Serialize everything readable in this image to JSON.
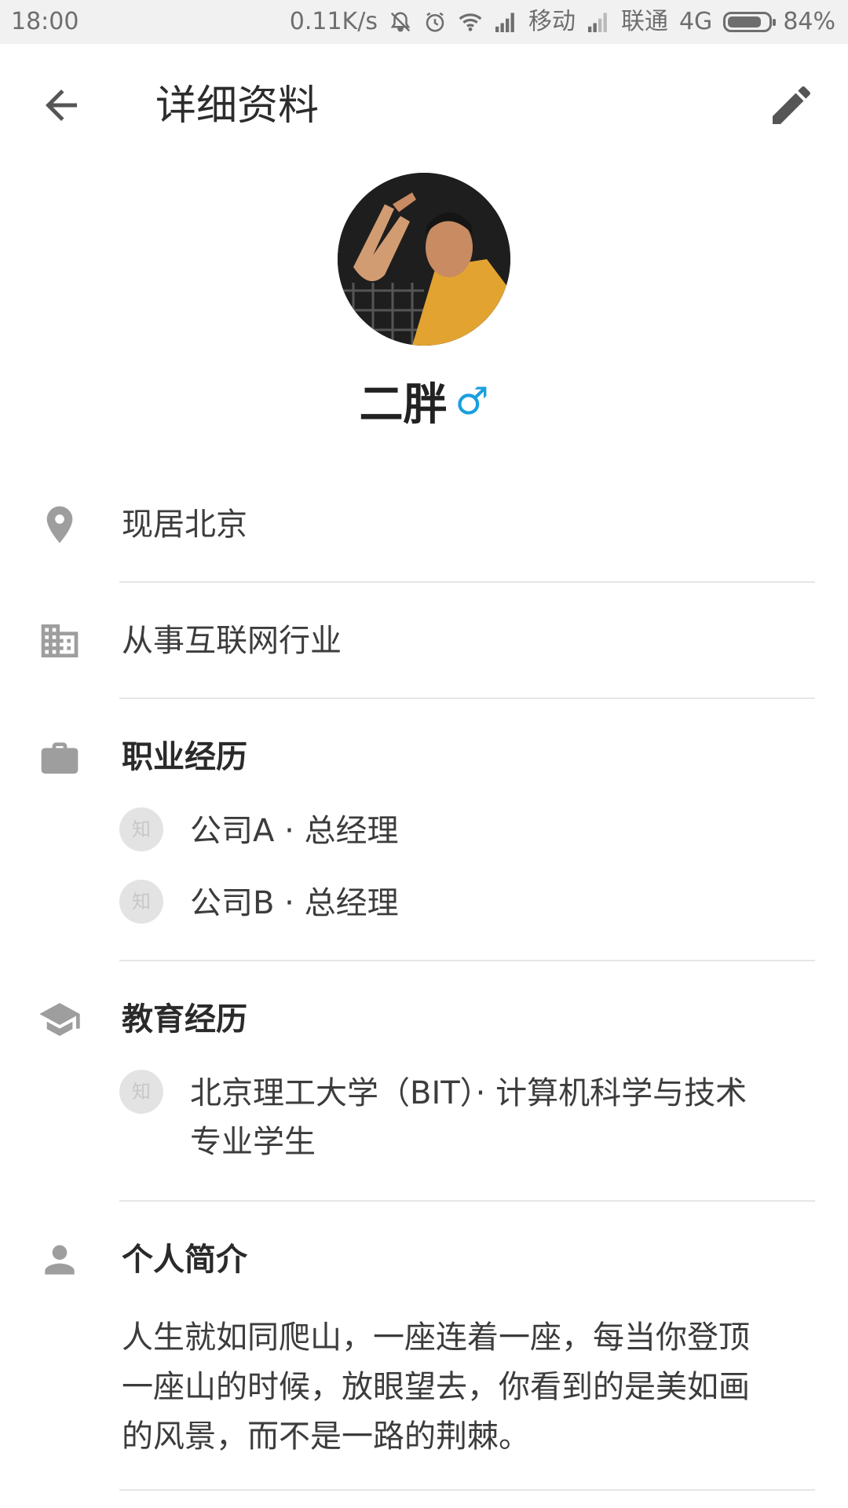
{
  "status_bar": {
    "time": "18:00",
    "speed": "0.11K/s",
    "carrier1": "移动",
    "carrier2": "联通",
    "network": "4G",
    "battery": "84%",
    "battery_level": 0.84,
    "icons": [
      "mute-icon",
      "alarm-icon",
      "wifi-icon",
      "signal-icon",
      "signal-icon",
      "battery-icon"
    ]
  },
  "header": {
    "title": "详细资料",
    "back_icon": "arrow-back-icon",
    "edit_icon": "pencil-icon"
  },
  "profile": {
    "name": "二胖",
    "gender_symbol": "♂",
    "gender_color": "#19a0dd"
  },
  "info": {
    "location": "现居北京",
    "industry": "从事互联网行业"
  },
  "career": {
    "title": "职业经历",
    "badge": "知",
    "items": [
      "公司A · 总经理",
      "公司B · 总经理"
    ]
  },
  "education": {
    "title": "教育经历",
    "badge": "知",
    "line1": "北京理工大学（BIT）· 计算机科学与技术",
    "line2": "专业学生"
  },
  "bio": {
    "title": "个人简介",
    "line1": "人生就如同爬山，一座连着一座，每当你登顶",
    "line2": "一座山的时候，放眼望去，你看到的是美如画",
    "line3": "的风景，而不是一路的荆棘。"
  }
}
